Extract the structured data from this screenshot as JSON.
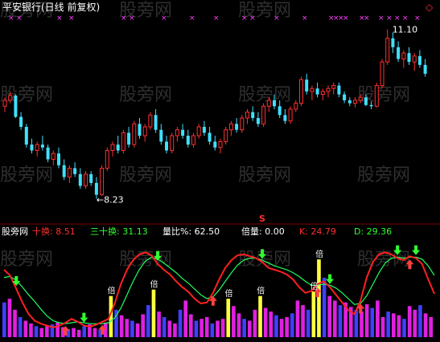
{
  "header": {
    "stock_name": "平安银行(日线 前复权)",
    "watermark": "股旁网",
    "diamond_icon": "◇",
    "high_label": "11.10",
    "low_label": "8.23",
    "s_marker": "S"
  },
  "indicator_header": {
    "name": "股旁网",
    "items": [
      {
        "key": "十换",
        "value": "8.51",
        "color": "#ff3030"
      },
      {
        "key": "三十换",
        "value": "31.13",
        "color": "#30ff30"
      },
      {
        "key": "量比%",
        "value": "62.50",
        "color": "#ffffff"
      }
    ],
    "right_items": [
      {
        "key": "倍量",
        "value": "0.00",
        "color": "#ffffff"
      },
      {
        "key": "K",
        "value": "24.79",
        "color": "#ff3030"
      },
      {
        "key": "D",
        "value": "29.36",
        "color": "#30ff30"
      }
    ],
    "bei_label": "倍"
  },
  "colors": {
    "up": "#ff3030",
    "down": "#40e0ff",
    "k_line": "#ff2020",
    "d_line": "#20ff60",
    "marker_x": "#ff40ff",
    "vol_magenta": "#e020e0",
    "vol_blue": "#4040ff",
    "vol_yellow": "#ffff40"
  },
  "chart_data": [
    {
      "type": "candlestick",
      "title": "平安银行(日线 前复权)",
      "ylim": [
        7.9,
        11.3
      ],
      "annotations": [
        {
          "text": "11.10",
          "value": 11.1
        },
        {
          "text": "8.23",
          "value": 8.23
        }
      ],
      "candles": [
        [
          9.8,
          9.95,
          9.7,
          9.9
        ],
        [
          9.9,
          10.05,
          9.85,
          9.98
        ],
        [
          9.98,
          10.0,
          9.6,
          9.62
        ],
        [
          9.62,
          9.7,
          9.4,
          9.45
        ],
        [
          9.45,
          9.5,
          9.1,
          9.15
        ],
        [
          9.15,
          9.25,
          9.0,
          9.05
        ],
        [
          9.05,
          9.2,
          8.95,
          9.15
        ],
        [
          9.15,
          9.3,
          9.05,
          9.1
        ],
        [
          9.1,
          9.15,
          8.85,
          8.9
        ],
        [
          8.9,
          9.05,
          8.8,
          9.0
        ],
        [
          9.0,
          9.1,
          8.75,
          8.8
        ],
        [
          8.8,
          8.9,
          8.55,
          8.6
        ],
        [
          8.6,
          8.8,
          8.5,
          8.75
        ],
        [
          8.75,
          8.85,
          8.6,
          8.65
        ],
        [
          8.65,
          8.75,
          8.4,
          8.45
        ],
        [
          8.45,
          8.7,
          8.4,
          8.65
        ],
        [
          8.65,
          8.7,
          8.45,
          8.5
        ],
        [
          8.5,
          8.6,
          8.23,
          8.3
        ],
        [
          8.3,
          8.8,
          8.28,
          8.75
        ],
        [
          8.75,
          9.1,
          8.7,
          9.05
        ],
        [
          9.05,
          9.2,
          8.95,
          9.15
        ],
        [
          9.15,
          9.3,
          9.0,
          9.05
        ],
        [
          9.05,
          9.4,
          9.0,
          9.35
        ],
        [
          9.35,
          9.45,
          9.1,
          9.15
        ],
        [
          9.15,
          9.55,
          9.1,
          9.5
        ],
        [
          9.5,
          9.6,
          9.25,
          9.3
        ],
        [
          9.3,
          9.5,
          9.2,
          9.45
        ],
        [
          9.45,
          9.7,
          9.4,
          9.65
        ],
        [
          9.65,
          9.75,
          9.35,
          9.4
        ],
        [
          9.4,
          9.5,
          9.15,
          9.2
        ],
        [
          9.2,
          9.3,
          9.0,
          9.05
        ],
        [
          9.05,
          9.35,
          9.0,
          9.3
        ],
        [
          9.3,
          9.45,
          9.2,
          9.4
        ],
        [
          9.4,
          9.5,
          9.25,
          9.3
        ],
        [
          9.3,
          9.4,
          9.1,
          9.15
        ],
        [
          9.15,
          9.35,
          9.1,
          9.3
        ],
        [
          9.3,
          9.5,
          9.25,
          9.45
        ],
        [
          9.45,
          9.55,
          9.3,
          9.35
        ],
        [
          9.35,
          9.45,
          9.15,
          9.2
        ],
        [
          9.2,
          9.3,
          9.05,
          9.1
        ],
        [
          9.1,
          9.25,
          9.0,
          9.2
        ],
        [
          9.2,
          9.45,
          9.15,
          9.4
        ],
        [
          9.4,
          9.55,
          9.3,
          9.5
        ],
        [
          9.5,
          9.6,
          9.35,
          9.4
        ],
        [
          9.4,
          9.65,
          9.35,
          9.6
        ],
        [
          9.6,
          9.75,
          9.5,
          9.7
        ],
        [
          9.7,
          9.8,
          9.55,
          9.6
        ],
        [
          9.6,
          9.7,
          9.45,
          9.5
        ],
        [
          9.5,
          9.85,
          9.45,
          9.8
        ],
        [
          9.8,
          9.95,
          9.7,
          9.9
        ],
        [
          9.9,
          10.0,
          9.75,
          9.8
        ],
        [
          9.8,
          9.9,
          9.6,
          9.65
        ],
        [
          9.65,
          9.75,
          9.5,
          9.55
        ],
        [
          9.55,
          9.8,
          9.5,
          9.75
        ],
        [
          9.75,
          9.9,
          9.7,
          9.85
        ],
        [
          9.85,
          10.3,
          9.8,
          10.25
        ],
        [
          10.25,
          10.35,
          10.0,
          10.05
        ],
        [
          10.05,
          10.15,
          9.9,
          10.1
        ],
        [
          10.1,
          10.2,
          9.95,
          10.0
        ],
        [
          10.0,
          10.1,
          9.9,
          10.05
        ],
        [
          10.05,
          10.15,
          9.95,
          10.1
        ],
        [
          10.1,
          10.2,
          10.0,
          10.15
        ],
        [
          10.15,
          10.2,
          9.95,
          10.0
        ],
        [
          10.0,
          10.05,
          9.85,
          9.9
        ],
        [
          9.9,
          9.95,
          9.8,
          9.85
        ],
        [
          9.85,
          9.95,
          9.78,
          9.9
        ],
        [
          9.9,
          10.0,
          9.85,
          9.95
        ],
        [
          9.95,
          10.0,
          9.8,
          9.82
        ],
        [
          9.82,
          9.88,
          9.75,
          9.8
        ],
        [
          9.8,
          10.2,
          9.78,
          10.15
        ],
        [
          10.15,
          10.6,
          10.1,
          10.55
        ],
        [
          10.55,
          11.1,
          10.5,
          10.95
        ],
        [
          10.95,
          11.05,
          10.7,
          10.8
        ],
        [
          10.8,
          10.9,
          10.55,
          10.6
        ],
        [
          10.6,
          10.75,
          10.45,
          10.7
        ],
        [
          10.7,
          10.8,
          10.5,
          10.55
        ],
        [
          10.55,
          10.7,
          10.4,
          10.65
        ],
        [
          10.65,
          10.75,
          10.45,
          10.5
        ],
        [
          10.5,
          10.6,
          10.3,
          10.35
        ]
      ]
    },
    {
      "type": "line",
      "title": "股旁网",
      "ylim": [
        0,
        100
      ],
      "series": [
        {
          "name": "K",
          "values": [
            70,
            64,
            50,
            36,
            24,
            17,
            14,
            12,
            10,
            12,
            15,
            19,
            16,
            12,
            11,
            13,
            16,
            19,
            35,
            55,
            70,
            80,
            86,
            88,
            85,
            76,
            70,
            65,
            58,
            52,
            47,
            40,
            35,
            36,
            46,
            60,
            72,
            80,
            85,
            86,
            84,
            82,
            78,
            72,
            70,
            68,
            65,
            60,
            52,
            46,
            48,
            55,
            58,
            52,
            44,
            36,
            28,
            24,
            38,
            62,
            78,
            86,
            88,
            86,
            82,
            80,
            84,
            82,
            76,
            60,
            45
          ]
        },
        {
          "name": "D",
          "values": [
            62,
            63,
            59,
            52,
            44,
            37,
            29,
            22,
            17,
            15,
            14,
            15,
            16,
            15,
            14,
            14,
            14,
            15,
            20,
            30,
            44,
            58,
            70,
            79,
            83,
            81,
            77,
            72,
            67,
            61,
            56,
            50,
            44,
            40,
            42,
            49,
            58,
            67,
            75,
            80,
            82,
            82,
            80,
            77,
            74,
            72,
            70,
            67,
            63,
            58,
            54,
            54,
            55,
            54,
            51,
            46,
            40,
            34,
            35,
            43,
            55,
            67,
            77,
            82,
            83,
            82,
            83,
            83,
            81,
            74,
            64
          ]
        }
      ]
    },
    {
      "type": "bar",
      "title": "股旁网",
      "values": [
        38,
        42,
        30,
        22,
        18,
        15,
        12,
        10,
        12,
        14,
        16,
        11,
        9,
        10,
        8,
        12,
        14,
        10,
        8,
        16,
        45,
        30,
        24,
        20,
        18,
        15,
        25,
        35,
        52,
        28,
        22,
        18,
        15,
        30,
        40,
        25,
        18,
        20,
        22,
        15,
        18,
        20,
        42,
        34,
        26,
        20,
        18,
        30,
        45,
        32,
        28,
        24,
        20,
        22,
        26,
        40,
        35,
        30,
        50,
        85,
        65,
        45,
        40,
        35,
        38,
        33,
        30,
        28,
        36,
        32,
        40,
        22,
        28,
        26,
        24,
        20,
        34,
        30,
        35,
        26,
        22
      ]
    }
  ]
}
